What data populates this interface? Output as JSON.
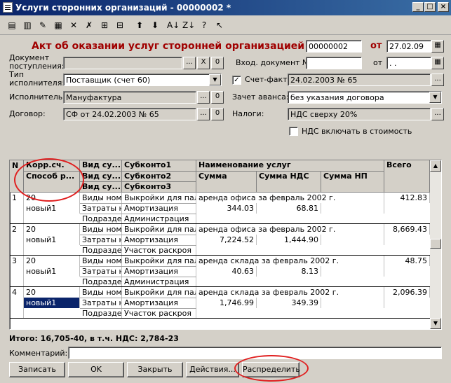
{
  "window": {
    "title": "Услуги сторонних организаций - 00000002 *",
    "minimize": "_",
    "maximize": "□",
    "close": "×"
  },
  "toolbar": {
    "buttons": [
      {
        "name": "new-doc-icon",
        "glyph": "▤"
      },
      {
        "name": "copy-doc-icon",
        "glyph": "▥"
      },
      {
        "name": "edit-doc-icon",
        "glyph": "✎"
      },
      {
        "name": "post-doc-icon",
        "glyph": "▦"
      },
      {
        "name": "delete-doc-icon",
        "glyph": "✕"
      },
      {
        "name": "mark-delete-icon",
        "glyph": "✗"
      },
      {
        "name": "add-row-icon",
        "glyph": "⊞"
      },
      {
        "name": "insert-row-icon",
        "glyph": "⊟"
      },
      {
        "name": "move-up-icon",
        "glyph": "⬆"
      },
      {
        "name": "move-down-icon",
        "glyph": "⬇"
      },
      {
        "name": "sort-asc-icon",
        "glyph": "A↓"
      },
      {
        "name": "sort-desc-icon",
        "glyph": "Z↓"
      },
      {
        "name": "help-icon",
        "glyph": "?"
      },
      {
        "name": "pointer-help-icon",
        "glyph": "↖"
      }
    ]
  },
  "form": {
    "heading": "Акт об оказании услуг сторонней организацией №",
    "doc_number": "00000002",
    "date_label": "от",
    "doc_date": "27.02.09",
    "receipt_doc_label": "Документ поступления:",
    "receipt_doc_value": "",
    "incoming_doc_label": "Вход. документ №",
    "incoming_doc_number": "",
    "incoming_date_label": "от",
    "incoming_date": " .  .",
    "executor_type_label": "Тип исполнителя:",
    "executor_type_value": "Поставщик (счет 60)",
    "invoice_label": "Счет-фактура:",
    "invoice_checked": "✓",
    "invoice_value": "24.02.2003 № 65",
    "executor_label": "Исполнитель:",
    "executor_value": "Мануфактура",
    "advance_label": "Зачет аванса:",
    "advance_value": "без указания договора",
    "contract_label": "Договор:",
    "contract_value": "СФ от 24.02.2003 № 65",
    "taxes_label": "Налоги:",
    "taxes_value": "НДС сверху 20%",
    "vat_include_label": "НДС включать в стоимость",
    "btn_dots": "...",
    "btn_x": "X",
    "btn_o": "0"
  },
  "grid": {
    "headers": {
      "n": "N",
      "korr": "Корр.сч.",
      "sposob": "Способ р...",
      "vid1": "Вид су...",
      "vid2": "Вид су...",
      "vid3": "Вид су...",
      "sub1": "Субконто1",
      "sub2": "Субконто2",
      "sub3": "Субконто3",
      "name": "Наименование услуг",
      "summa": "Сумма",
      "summa_nds": "Сумма НДС",
      "summa_np": "Сумма НП",
      "total": "Всего"
    },
    "rows": [
      {
        "n": "1",
        "korr": "20",
        "sposob": "новый1",
        "vid": [
          "Виды номе",
          "Затраты н",
          "Подразде"
        ],
        "sub": [
          "Выкройки для пальт",
          "Амортизация",
          "Администрация"
        ],
        "name": "аренда офиса за февраль 2002 г.",
        "summa": "344.03",
        "nds": "68.81",
        "np": "",
        "total": "412.83"
      },
      {
        "n": "2",
        "korr": "20",
        "sposob": "новый1",
        "vid": [
          "Виды номе",
          "Затраты н",
          "Подразде"
        ],
        "sub": [
          "Выкройки для пальт",
          "Амортизация",
          "Участок раскроя"
        ],
        "name": "аренда офиса за февраль 2002 г.",
        "summa": "7,224.52",
        "nds": "1,444.90",
        "np": "",
        "total": "8,669.43"
      },
      {
        "n": "3",
        "korr": "20",
        "sposob": "новый1",
        "vid": [
          "Виды номе",
          "Затраты н",
          "Подразде"
        ],
        "sub": [
          "Выкройки для пальт",
          "Амортизация",
          "Администрация"
        ],
        "name": "аренда склада за февраль 2002 г.",
        "summa": "40.63",
        "nds": "8.13",
        "np": "",
        "total": "48.75"
      },
      {
        "n": "4",
        "korr": "20",
        "sposob": "новый1",
        "vid": [
          "Виды номе",
          "Затраты н",
          "Подразде"
        ],
        "sub": [
          "Выкройки для пальт",
          "Амортизация",
          "Участок раскроя"
        ],
        "name": "аренда склада за февраль 2002 г.",
        "summa": "1,746.99",
        "nds": "349.39",
        "np": "",
        "total": "2,096.39"
      }
    ]
  },
  "footer": {
    "totals": "Итого: 16,705-40, в т.ч. НДС: 2,784-23",
    "comment_label": "Комментарий:",
    "comment_value": "",
    "buttons": {
      "save": "Записать",
      "ok": "OK",
      "close": "Закрыть",
      "actions": "Действия...",
      "distribute": "Распределить"
    }
  },
  "colors": {
    "title_bar": "#0a246a",
    "heading": "#a00000",
    "highlight_circle": "#e02020",
    "selection": "#0a246a"
  }
}
